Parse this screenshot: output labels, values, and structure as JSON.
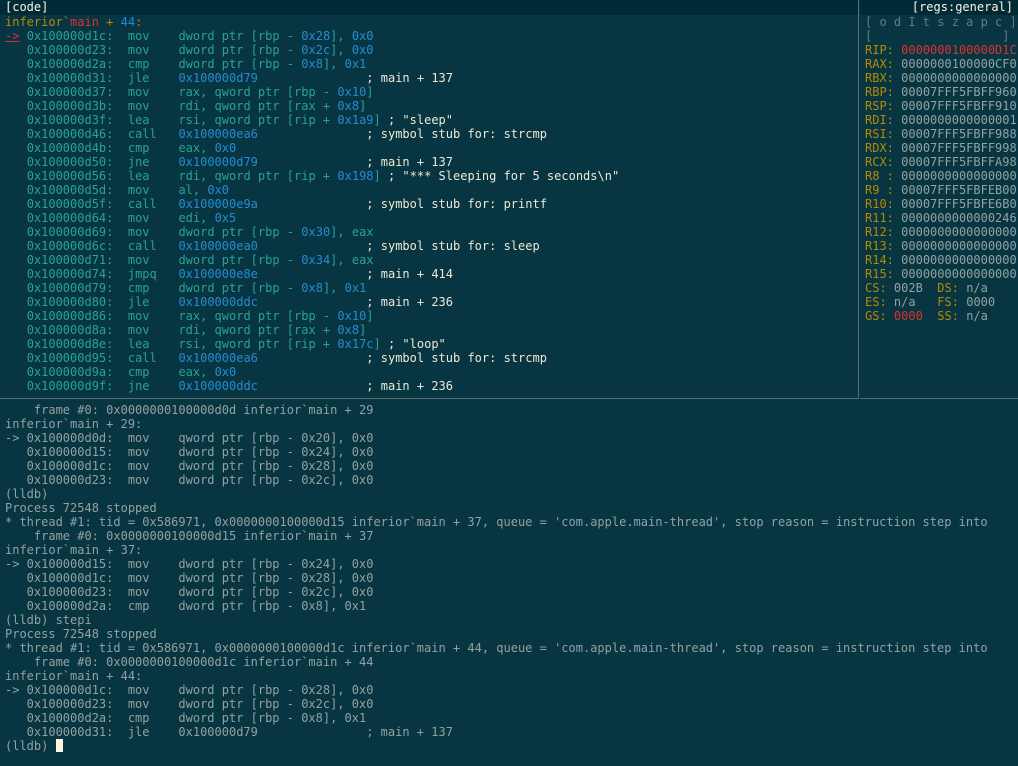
{
  "code_pane": {
    "title": "[code]",
    "header": {
      "module": "inferior`",
      "func": "main",
      "suffix": " + ",
      "offset": "44",
      "colon": ":"
    },
    "rows": [
      {
        "arrow": "->",
        "addr": "0x100000d1c:",
        "mnem": "mov",
        "pre": "dword ptr [rbp - ",
        "num": "0x28",
        "post": "], ",
        "imm": "0x0",
        "cmt": ""
      },
      {
        "arrow": "",
        "addr": "0x100000d23:",
        "mnem": "mov",
        "pre": "dword ptr [rbp - ",
        "num": "0x2c",
        "post": "], ",
        "imm": "0x0",
        "cmt": ""
      },
      {
        "arrow": "",
        "addr": "0x100000d2a:",
        "mnem": "cmp",
        "pre": "dword ptr [rbp - ",
        "num": "0x8",
        "post": "], ",
        "imm": "0x1",
        "cmt": ""
      },
      {
        "arrow": "",
        "addr": "0x100000d31:",
        "mnem": "jle",
        "pre": "",
        "num": "0x100000d79",
        "post": "",
        "imm": "",
        "cmt": "; main + 137"
      },
      {
        "arrow": "",
        "addr": "0x100000d37:",
        "mnem": "mov",
        "pre": "rax, qword ptr [rbp - ",
        "num": "0x10",
        "post": "]",
        "imm": "",
        "cmt": ""
      },
      {
        "arrow": "",
        "addr": "0x100000d3b:",
        "mnem": "mov",
        "pre": "rdi, qword ptr [rax + ",
        "num": "0x8",
        "post": "]",
        "imm": "",
        "cmt": ""
      },
      {
        "arrow": "",
        "addr": "0x100000d3f:",
        "mnem": "lea",
        "pre": "rsi, qword ptr [rip + ",
        "num": "0x1a9",
        "post": "]",
        "imm": "",
        "cmt": "; \"sleep\""
      },
      {
        "arrow": "",
        "addr": "0x100000d46:",
        "mnem": "call",
        "pre": "",
        "num": "0x100000ea6",
        "post": "",
        "imm": "",
        "cmt": "; symbol stub for: strcmp"
      },
      {
        "arrow": "",
        "addr": "0x100000d4b:",
        "mnem": "cmp",
        "pre": "eax, ",
        "num": "0x0",
        "post": "",
        "imm": "",
        "cmt": ""
      },
      {
        "arrow": "",
        "addr": "0x100000d50:",
        "mnem": "jne",
        "pre": "",
        "num": "0x100000d79",
        "post": "",
        "imm": "",
        "cmt": "; main + 137"
      },
      {
        "arrow": "",
        "addr": "0x100000d56:",
        "mnem": "lea",
        "pre": "rdi, qword ptr [rip + ",
        "num": "0x198",
        "post": "]",
        "imm": "",
        "cmt": "; \"*** Sleeping for 5 seconds\\n\""
      },
      {
        "arrow": "",
        "addr": "0x100000d5d:",
        "mnem": "mov",
        "pre": "al, ",
        "num": "0x0",
        "post": "",
        "imm": "",
        "cmt": ""
      },
      {
        "arrow": "",
        "addr": "0x100000d5f:",
        "mnem": "call",
        "pre": "",
        "num": "0x100000e9a",
        "post": "",
        "imm": "",
        "cmt": "; symbol stub for: printf"
      },
      {
        "arrow": "",
        "addr": "0x100000d64:",
        "mnem": "mov",
        "pre": "edi, ",
        "num": "0x5",
        "post": "",
        "imm": "",
        "cmt": ""
      },
      {
        "arrow": "",
        "addr": "0x100000d69:",
        "mnem": "mov",
        "pre": "dword ptr [rbp - ",
        "num": "0x30",
        "post": "], eax",
        "imm": "",
        "cmt": ""
      },
      {
        "arrow": "",
        "addr": "0x100000d6c:",
        "mnem": "call",
        "pre": "",
        "num": "0x100000ea0",
        "post": "",
        "imm": "",
        "cmt": "; symbol stub for: sleep"
      },
      {
        "arrow": "",
        "addr": "0x100000d71:",
        "mnem": "mov",
        "pre": "dword ptr [rbp - ",
        "num": "0x34",
        "post": "], eax",
        "imm": "",
        "cmt": ""
      },
      {
        "arrow": "",
        "addr": "0x100000d74:",
        "mnem": "jmpq",
        "pre": "",
        "num": "0x100000e8e",
        "post": "",
        "imm": "",
        "cmt": "; main + 414"
      },
      {
        "arrow": "",
        "addr": "0x100000d79:",
        "mnem": "cmp",
        "pre": "dword ptr [rbp - ",
        "num": "0x8",
        "post": "], ",
        "imm": "0x1",
        "cmt": ""
      },
      {
        "arrow": "",
        "addr": "0x100000d80:",
        "mnem": "jle",
        "pre": "",
        "num": "0x100000ddc",
        "post": "",
        "imm": "",
        "cmt": "; main + 236"
      },
      {
        "arrow": "",
        "addr": "0x100000d86:",
        "mnem": "mov",
        "pre": "rax, qword ptr [rbp - ",
        "num": "0x10",
        "post": "]",
        "imm": "",
        "cmt": ""
      },
      {
        "arrow": "",
        "addr": "0x100000d8a:",
        "mnem": "mov",
        "pre": "rdi, qword ptr [rax + ",
        "num": "0x8",
        "post": "]",
        "imm": "",
        "cmt": ""
      },
      {
        "arrow": "",
        "addr": "0x100000d8e:",
        "mnem": "lea",
        "pre": "rsi, qword ptr [rip + ",
        "num": "0x17c",
        "post": "]",
        "imm": "",
        "cmt": "; \"loop\""
      },
      {
        "arrow": "",
        "addr": "0x100000d95:",
        "mnem": "call",
        "pre": "",
        "num": "0x100000ea6",
        "post": "",
        "imm": "",
        "cmt": "; symbol stub for: strcmp"
      },
      {
        "arrow": "",
        "addr": "0x100000d9a:",
        "mnem": "cmp",
        "pre": "eax, ",
        "num": "0x0",
        "post": "",
        "imm": "",
        "cmt": ""
      },
      {
        "arrow": "",
        "addr": "0x100000d9f:",
        "mnem": "jne",
        "pre": "",
        "num": "0x100000ddc",
        "post": "",
        "imm": "",
        "cmt": "; main + 236"
      }
    ]
  },
  "regs_pane": {
    "title": "[regs:general]",
    "flags_header": "[ o d I t s z a p c ]",
    "flags_values": "[                  ]",
    "registers": [
      {
        "name": "RIP:",
        "value": "0000000100000D1C",
        "hot": true
      },
      {
        "name": "RAX:",
        "value": "0000000100000CF0",
        "hot": false
      },
      {
        "name": "RBX:",
        "value": "0000000000000000",
        "hot": false
      },
      {
        "name": "RBP:",
        "value": "00007FFF5FBFF960",
        "hot": false
      },
      {
        "name": "RSP:",
        "value": "00007FFF5FBFF910",
        "hot": false
      },
      {
        "name": "RDI:",
        "value": "0000000000000001",
        "hot": false
      },
      {
        "name": "RSI:",
        "value": "00007FFF5FBFF988",
        "hot": false
      },
      {
        "name": "RDX:",
        "value": "00007FFF5FBFF998",
        "hot": false
      },
      {
        "name": "RCX:",
        "value": "00007FFF5FBFFA98",
        "hot": false
      },
      {
        "name": "R8 :",
        "value": "0000000000000000",
        "hot": false
      },
      {
        "name": "R9 :",
        "value": "00007FFF5FBFEB00",
        "hot": false
      },
      {
        "name": "R10:",
        "value": "00007FFF5FBFE6B0",
        "hot": false
      },
      {
        "name": "R11:",
        "value": "0000000000000246",
        "hot": false
      },
      {
        "name": "R12:",
        "value": "0000000000000000",
        "hot": false
      },
      {
        "name": "R13:",
        "value": "0000000000000000",
        "hot": false
      },
      {
        "name": "R14:",
        "value": "0000000000000000",
        "hot": false
      },
      {
        "name": "R15:",
        "value": "0000000000000000",
        "hot": false
      }
    ],
    "segments": [
      [
        {
          "name": "CS:",
          "value": "002B",
          "hot": false
        },
        {
          "name": "DS:",
          "value": "n/a",
          "hot": false
        }
      ],
      [
        {
          "name": "ES:",
          "value": "n/a",
          "hot": false
        },
        {
          "name": "FS:",
          "value": "0000",
          "hot": false
        }
      ],
      [
        {
          "name": "GS:",
          "value": "0000",
          "hot": true
        },
        {
          "name": "SS:",
          "value": "n/a",
          "hot": false
        }
      ]
    ]
  },
  "command_pane": {
    "lines": [
      "    frame #0: 0x0000000100000d0d inferior`main + 29",
      "inferior`main + 29:",
      "-> 0x100000d0d:  mov    qword ptr [rbp - 0x20], 0x0",
      "   0x100000d15:  mov    dword ptr [rbp - 0x24], 0x0",
      "   0x100000d1c:  mov    dword ptr [rbp - 0x28], 0x0",
      "   0x100000d23:  mov    dword ptr [rbp - 0x2c], 0x0",
      "(lldb)",
      "Process 72548 stopped",
      "* thread #1: tid = 0x586971, 0x0000000100000d15 inferior`main + 37, queue = 'com.apple.main-thread', stop reason = instruction step into",
      "    frame #0: 0x0000000100000d15 inferior`main + 37",
      "inferior`main + 37:",
      "-> 0x100000d15:  mov    dword ptr [rbp - 0x24], 0x0",
      "   0x100000d1c:  mov    dword ptr [rbp - 0x28], 0x0",
      "   0x100000d23:  mov    dword ptr [rbp - 0x2c], 0x0",
      "   0x100000d2a:  cmp    dword ptr [rbp - 0x8], 0x1",
      "(lldb) stepi",
      "Process 72548 stopped",
      "* thread #1: tid = 0x586971, 0x0000000100000d1c inferior`main + 44, queue = 'com.apple.main-thread', stop reason = instruction step into",
      "    frame #0: 0x0000000100000d1c inferior`main + 44",
      "inferior`main + 44:",
      "-> 0x100000d1c:  mov    dword ptr [rbp - 0x28], 0x0",
      "   0x100000d23:  mov    dword ptr [rbp - 0x2c], 0x0",
      "   0x100000d2a:  cmp    dword ptr [rbp - 0x8], 0x1",
      "   0x100000d31:  jle    0x100000d79               ; main + 137"
    ],
    "prompt": "(lldb) ",
    "input_value": ""
  }
}
